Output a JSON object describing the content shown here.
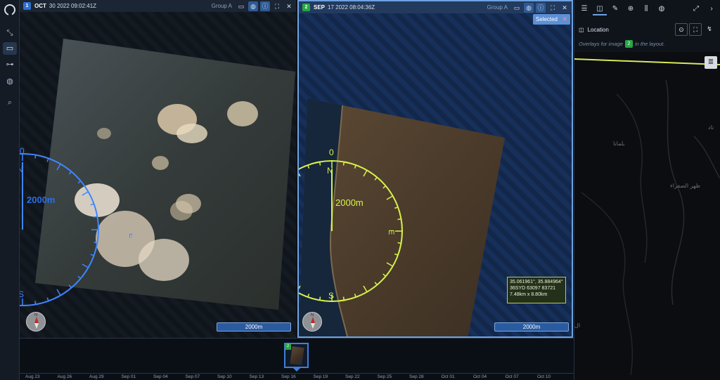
{
  "left_rail": {
    "buttons": [
      {
        "icon": "logo-icon"
      },
      {
        "icon": "tools-icon"
      },
      {
        "icon": "image-icon"
      },
      {
        "icon": "compare-icon"
      },
      {
        "icon": "globe-icon"
      },
      {
        "icon": "search-icon"
      }
    ]
  },
  "pane1": {
    "number": "1",
    "month": "OCT",
    "date_time": "30 2022   09:02:41Z",
    "group": "Group A",
    "scale_label": "2000m",
    "compass": {
      "distance_label": "2000m",
      "n": "N",
      "e": "E",
      "s": "S",
      "zero": "0",
      "color": "#3f86ff"
    }
  },
  "pane2": {
    "number": "2",
    "month": "SEP",
    "date_time": "17 2022   08:04:36Z",
    "group": "Group A",
    "selected_label": "Selected",
    "scale_label": "2000m",
    "compass": {
      "distance_label": "2000m",
      "n": "N",
      "e": "E",
      "s": "S",
      "zero": "0",
      "color": "#d8f24a"
    },
    "coords": {
      "latlon": "35.061961°, 35.884964°",
      "mgrs": "36SYD 63097 83721",
      "extent": "7.48km x 8.80km"
    }
  },
  "north_indicator": "N",
  "timeline": {
    "thumb_badge": "2",
    "ticks": [
      "Aug 23",
      "Aug 26",
      "Aug 29",
      "Sep 01",
      "Sep 04",
      "Sep 07",
      "Sep 10",
      "Sep 13",
      "Sep 16",
      "Sep 19",
      "Sep 22",
      "Sep 25",
      "Sep 28",
      "Oct 01",
      "Oct 04",
      "Oct 07",
      "Oct 10"
    ]
  },
  "right_panel": {
    "location_label": "Location",
    "overlay_note_prefix": "Overlays for image",
    "overlay_note_badge": "2",
    "overlay_note_suffix": "in the layout.",
    "map_labels": [
      "بلمانا",
      "ظهر الصفراء",
      "تاد",
      "ال"
    ]
  }
}
